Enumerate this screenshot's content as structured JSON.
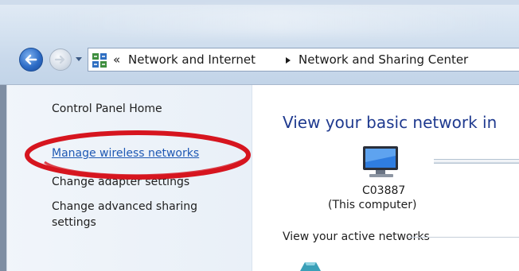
{
  "address_bar": {
    "overflow_chevrons": "«",
    "breadcrumb": [
      "Network and Internet",
      "Network and Sharing Center"
    ]
  },
  "icons": {
    "back": "back-arrow-icon",
    "forward": "forward-arrow-icon",
    "dropdown": "chevron-down-icon",
    "control_panel": "control-panel-icon",
    "crumb_separator": "triangle-right-icon",
    "computer": "computer-icon",
    "network": "network-icon"
  },
  "left_pane": {
    "home": "Control Panel Home",
    "manage_wireless": "Manage wireless networks",
    "change_adapter": "Change adapter settings",
    "advanced_line1": "Change advanced sharing",
    "advanced_line2": "settings"
  },
  "main": {
    "title": "View your basic network in",
    "computer_name": "C03887",
    "computer_sub": "(This computer)",
    "active_networks": "View your active networks"
  },
  "colors": {
    "link": "#1f59b4",
    "title": "#1f3a8f",
    "annotation": "#d6151f"
  }
}
